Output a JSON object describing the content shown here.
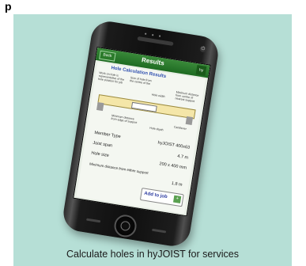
{
  "corner_mark": "p",
  "caption": "Calculate holes in hyJOIST for services",
  "phone": {
    "dots": "• • •",
    "screen": {
      "back_label": "Back",
      "title": "Results",
      "logo_text": "hy",
      "heading": "Hole Calculation Results",
      "note_left": "Work on hole is representative of the hole position for job",
      "note_top": "Size of hole from the centre of the",
      "note_hole_width": "Hole width",
      "note_right": "Minimum distance from centre of nearest support",
      "note_support": "Minimum distance from edge of support",
      "note_hole": "Hole depth",
      "note_cantilever": "Cantilever",
      "rows": [
        {
          "label": "Member Type",
          "value": "hyJOIST 400x63"
        },
        {
          "label": "Joist span",
          "value": "4.7 m"
        },
        {
          "label": "Hole size",
          "value": "200 x 400 mm"
        }
      ],
      "min_label": "Minimum distance from either support",
      "min_value": "1.8 m",
      "add_button": "Add to job"
    }
  }
}
